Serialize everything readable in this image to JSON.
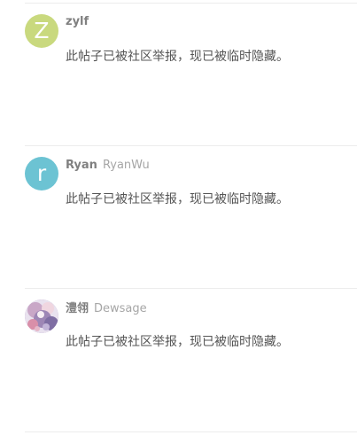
{
  "posts": [
    {
      "avatar_letter": "Z",
      "avatar_color": "#c9d97e",
      "username": "zylf",
      "full_name": "",
      "body": "此帖子已被社区举报，现已被临时隐藏。"
    },
    {
      "avatar_letter": "r",
      "avatar_color": "#6cc3d3",
      "username": "Ryan",
      "full_name": "RyanWu",
      "body": "此帖子已被社区举报，现已被临时隐藏。"
    },
    {
      "avatar_letter": "",
      "avatar_color": "#b8a6c8",
      "username": "澧翎",
      "full_name": "Dewsage",
      "body": "此帖子已被社区举报，现已被临时隐藏。"
    }
  ]
}
